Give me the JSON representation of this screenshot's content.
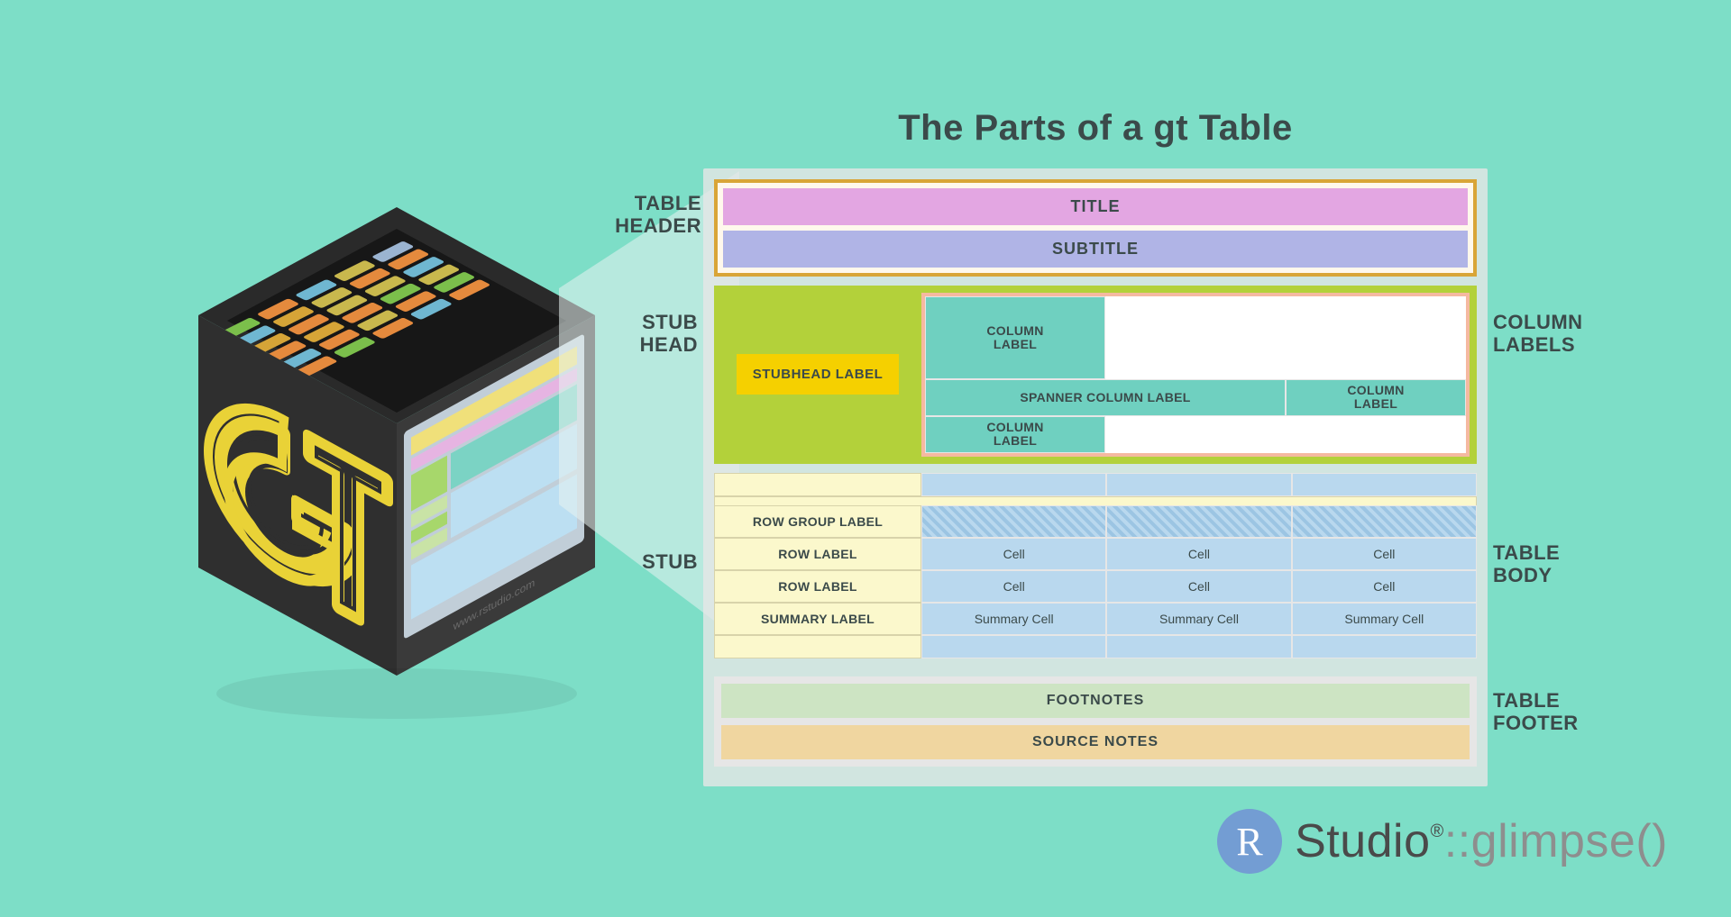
{
  "title": "The Parts of a gt Table",
  "cube_url_text": "www.rstudio.com",
  "side_labels": {
    "header": "TABLE\nHEADER",
    "stubhead": "STUB\nHEAD",
    "stub": "STUB",
    "column_labels": "COLUMN\nLABELS",
    "table_body": "TABLE\nBODY",
    "table_footer": "TABLE\nFOOTER"
  },
  "header": {
    "title": "TITLE",
    "subtitle": "SUBTITLE"
  },
  "stubhead": {
    "label": "STUBHEAD LABEL"
  },
  "column_labels": {
    "spanner": "SPANNER COLUMN LABEL",
    "col1": "COLUMN LABEL",
    "col2": "COLUMN LABEL",
    "col3": "COLUMN LABEL"
  },
  "body": {
    "row_group": "ROW GROUP LABEL",
    "rows": [
      {
        "label": "ROW LABEL",
        "cells": [
          "Cell",
          "Cell",
          "Cell"
        ]
      },
      {
        "label": "ROW LABEL",
        "cells": [
          "Cell",
          "Cell",
          "Cell"
        ]
      }
    ],
    "summary": {
      "label": "SUMMARY LABEL",
      "cells": [
        "Summary Cell",
        "Summary Cell",
        "Summary Cell"
      ]
    }
  },
  "footer": {
    "footnotes": "FOOTNOTES",
    "source_notes": "SOURCE NOTES"
  },
  "brand": {
    "r": "R",
    "studio": "Studio",
    "sep": "::",
    "func": "glimpse()"
  }
}
